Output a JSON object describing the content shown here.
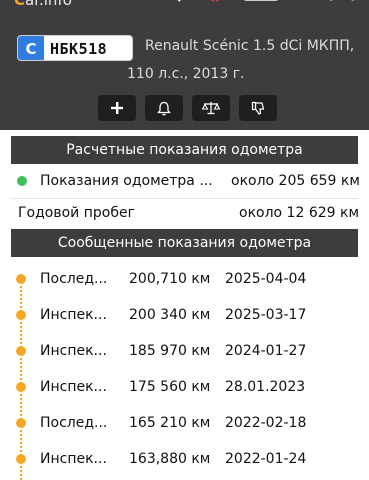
{
  "header": {
    "logo_prefix": "C",
    "logo_text": "ar.info",
    "plate_country": "C",
    "plate_number": "НБК518",
    "title_line1": "Renault Scénic 1.5 dCi МКПП,",
    "title_line2": "110 л.с., 2013 г."
  },
  "actions": [
    {
      "icon": "plus-icon"
    },
    {
      "icon": "bell-icon"
    },
    {
      "icon": "scales-icon"
    },
    {
      "icon": "thumbs-down-icon"
    }
  ],
  "calculated": {
    "title": "Расчетные показания одометра",
    "row_label": "Показания одометра ...",
    "row_value": "около 205 659 км",
    "annual_label": "Годовой пробег",
    "annual_value": "около 12 629 км",
    "status_color": "#3fbf5a"
  },
  "reported": {
    "title": "Сообщенные показания одометра",
    "accent_color": "#f5a623",
    "rows": [
      {
        "type": "Послед...",
        "km": "200,710 км",
        "date": "2025-04-04"
      },
      {
        "type": "Инспек...",
        "km": "200 340 км",
        "date": "2025-03-17"
      },
      {
        "type": "Инспек...",
        "km": "185 970 км",
        "date": "2024-01-27"
      },
      {
        "type": "Инспек...",
        "km": "175 560 км",
        "date": "28.01.2023"
      },
      {
        "type": "Послед...",
        "km": "165 210 км",
        "date": "2022-02-18"
      },
      {
        "type": "Инспек...",
        "km": "163,880 км",
        "date": "2022-01-24"
      }
    ]
  }
}
